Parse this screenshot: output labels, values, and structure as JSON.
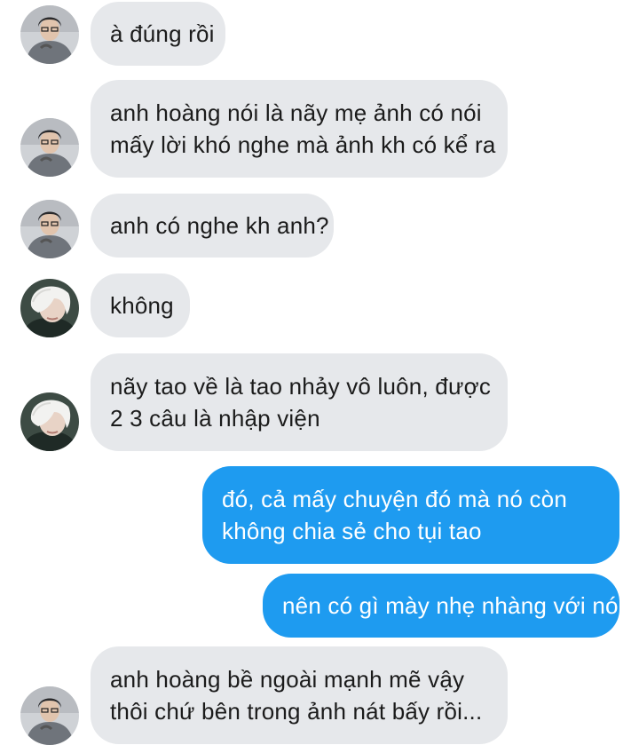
{
  "messages": [
    {
      "sender": "them",
      "avatar": "male-avatar",
      "lines": [
        "à đúng rồi"
      ]
    },
    {
      "sender": "them",
      "avatar": "male-avatar",
      "lines": [
        "anh hoàng nói là nãy mẹ ảnh có nói",
        "mấy lời khó nghe mà ảnh kh có kể ra"
      ]
    },
    {
      "sender": "them",
      "avatar": "male-avatar",
      "lines": [
        "anh có nghe kh anh?"
      ]
    },
    {
      "sender": "them",
      "avatar": "white-hair-avatar",
      "lines": [
        "không"
      ]
    },
    {
      "sender": "them",
      "avatar": "white-hair-avatar",
      "lines": [
        "nãy tao về là tao nhảy vô luôn, được",
        "2 3 câu là nhập viện"
      ]
    },
    {
      "sender": "me",
      "lines": [
        "đó, cả mấy chuyện đó mà nó còn",
        "không chia sẻ cho tụi tao"
      ]
    },
    {
      "sender": "me",
      "lines": [
        "nên có gì mày nhẹ nhàng với nó"
      ]
    },
    {
      "sender": "them",
      "avatar": "male-avatar",
      "lines": [
        "anh hoàng bề ngoài mạnh mẽ vậy",
        "thôi chứ bên trong ảnh nát bấy rồi..."
      ]
    }
  ],
  "colors": {
    "incoming_bubble": "#e6e8eb",
    "outgoing_bubble": "#1e9bf0"
  }
}
